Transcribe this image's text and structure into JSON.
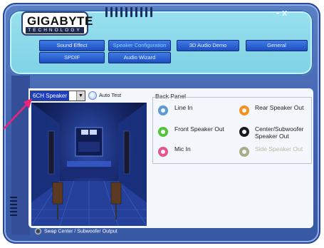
{
  "brand": {
    "name": "GIGABYTE",
    "tagline": "TECHNOLOGY"
  },
  "window": {
    "controls": "- x"
  },
  "nav": [
    {
      "label": "Sound Effect",
      "active": false
    },
    {
      "label": "Speaker Configuration",
      "active": true
    },
    {
      "label": "3D Audio Demo",
      "active": false
    },
    {
      "label": "General",
      "active": false
    },
    {
      "label": "SPDIF",
      "active": false
    },
    {
      "label": "Audio Wizard",
      "active": false
    }
  ],
  "speaker_select": {
    "value": "6CH Speaker",
    "options_visible": [
      "6CH Speaker"
    ]
  },
  "auto_test": {
    "label": "Auto Test"
  },
  "back_panel": {
    "title": "Back Panel",
    "jacks": [
      {
        "label": "Line In",
        "color": "#5d9ad6"
      },
      {
        "label": "Rear Speaker Out",
        "color": "#f39221"
      },
      {
        "label": "Front Speaker Out",
        "color": "#52c33c"
      },
      {
        "label": "Center/Subwoofer Speaker Out",
        "color": "#1a1a1a"
      },
      {
        "label": "Mic In",
        "color": "#e3578c"
      },
      {
        "label": "Side Speaker Out",
        "color": "#a8ad8a",
        "disabled": true
      }
    ]
  },
  "swap_option": {
    "label": "Swap Center / Subwoofer Output"
  },
  "icons": {
    "speaker-dropdown": "chevron-down-icon",
    "auto-test": "radio-icon",
    "pointer": "arrow-icon"
  },
  "colors": {
    "accent": "#f0237a",
    "frame": "#3e61ad",
    "header": "#8ad8ea"
  }
}
